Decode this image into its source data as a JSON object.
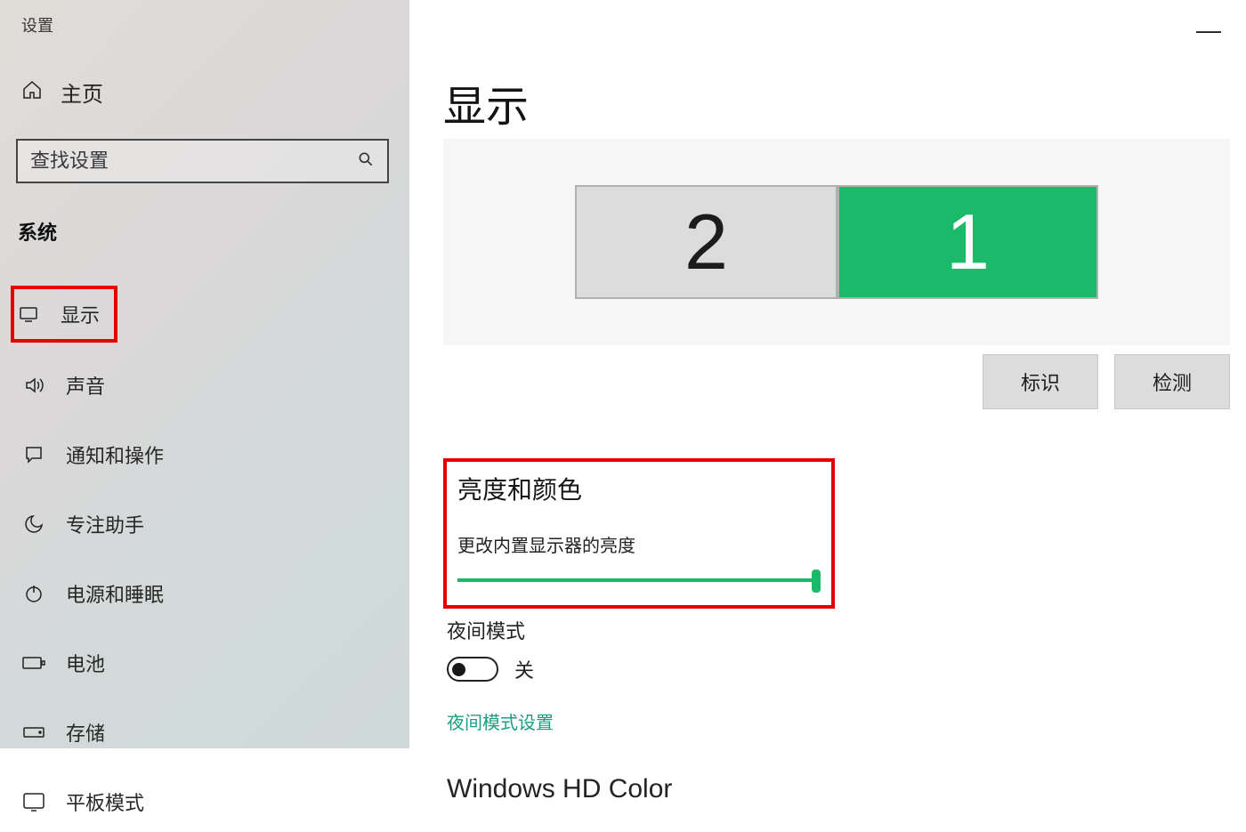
{
  "window": {
    "title": "设置"
  },
  "sidebar": {
    "home": "主页",
    "search_placeholder": "查找设置",
    "section_title": "系统",
    "items": [
      {
        "label": "显示"
      },
      {
        "label": "声音"
      },
      {
        "label": "通知和操作"
      },
      {
        "label": "专注助手"
      },
      {
        "label": "电源和睡眠"
      },
      {
        "label": "电池"
      },
      {
        "label": "存储"
      },
      {
        "label": "平板模式"
      }
    ]
  },
  "main": {
    "title": "显示",
    "monitors": {
      "monitor2": "2",
      "monitor1": "1"
    },
    "buttons": {
      "identify": "标识",
      "detect": "检测"
    },
    "brightness": {
      "section_title": "亮度和颜色",
      "slider_label": "更改内置显示器的亮度",
      "value": 100
    },
    "night_mode": {
      "label": "夜间模式",
      "state": "关",
      "settings_link": "夜间模式设置"
    },
    "hd_color_title": "Windows HD Color"
  }
}
